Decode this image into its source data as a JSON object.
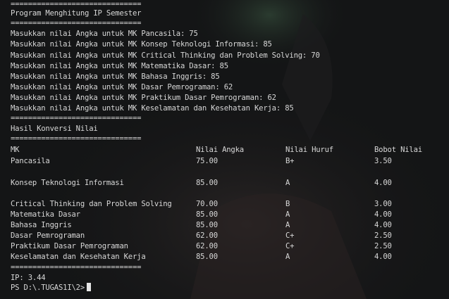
{
  "terminal": {
    "separator": "==============================",
    "program_title": "Program Menghitung IP Semester",
    "inputs": [
      "Masukkan nilai Angka untuk MK Pancasila: 75",
      "Masukkan nilai Angka untuk MK Konsep Teknologi Informasi: 85",
      "Masukkan nilai Angka untuk MK Critical Thinking dan Problem Solving: 70",
      "Masukkan nilai Angka untuk MK Matematika Dasar: 85",
      "Masukkan nilai Angka untuk MK Bahasa Inggris: 85",
      "Masukkan nilai Angka untuk MK Dasar Pemrograman: 62",
      "Masukkan nilai Angka untuk MK Praktikum Dasar Pemrograman: 62",
      "Masukkan nilai Angka untuk MK Keselamatan dan Kesehatan Kerja: 85"
    ],
    "result_title": "Hasil Konversi Nilai",
    "table": {
      "headers": [
        "MK",
        "Nilai Angka",
        "Nilai Huruf",
        "Bobot Nilai"
      ],
      "rows": [
        [
          "Pancasila",
          "75.00",
          "B+",
          "3.50"
        ],
        [
          "Konsep Teknologi Informasi",
          "85.00",
          "A",
          "4.00"
        ],
        [
          "Critical Thinking dan Problem Solving",
          "70.00",
          "B",
          "3.00"
        ],
        [
          "Matematika Dasar",
          "85.00",
          "A",
          "4.00"
        ],
        [
          "Bahasa Inggris",
          "85.00",
          "A",
          "4.00"
        ],
        [
          "Dasar Pemrograman",
          "62.00",
          "C+",
          "2.50"
        ],
        [
          "Praktikum Dasar Pemrograman",
          "62.00",
          "C+",
          "2.50"
        ],
        [
          "Keselamatan dan Kesehatan Kerja",
          "85.00",
          "A",
          "4.00"
        ]
      ]
    },
    "ip_result": "IP: 3.44",
    "prompt": "PS D:\\.TUGAS1I\\2>"
  },
  "colors": {
    "background": "#141516",
    "text": "#d7d7d7",
    "cursor": "#e6e6e6"
  }
}
